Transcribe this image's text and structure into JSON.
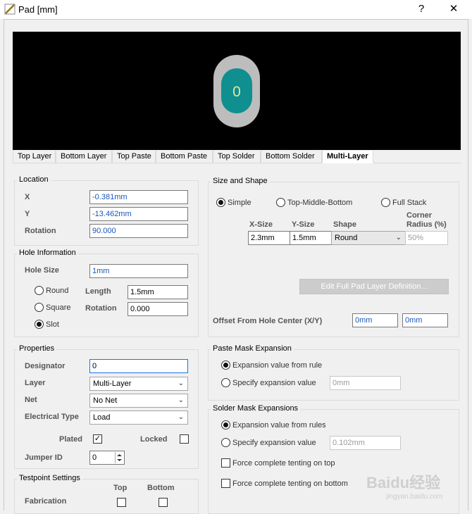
{
  "window": {
    "title": "Pad [mm]",
    "help": "?",
    "close": "✕"
  },
  "preview": {
    "pad_designator": "0"
  },
  "layer_tabs": [
    "Top Layer",
    "Bottom Layer",
    "Top Paste",
    "Bottom Paste",
    "Top Solder",
    "Bottom Solder",
    "Multi-Layer"
  ],
  "active_tab": "Multi-Layer",
  "location": {
    "title": "Location",
    "x_label": "X",
    "x_value": "-0.381mm",
    "y_label": "Y",
    "y_value": "-13.462mm",
    "rotation_label": "Rotation",
    "rotation_value": "90.000"
  },
  "hole": {
    "title": "Hole Information",
    "size_label": "Hole Size",
    "size_value": "1mm",
    "round_label": "Round",
    "square_label": "Square",
    "slot_label": "Slot",
    "selected": "Slot",
    "length_label": "Length",
    "length_value": "1.5mm",
    "rotation_label": "Rotation",
    "rotation_value": "0.000"
  },
  "properties": {
    "title": "Properties",
    "designator_label": "Designator",
    "designator_value": "0",
    "layer_label": "Layer",
    "layer_value": "Multi-Layer",
    "net_label": "Net",
    "net_value": "No Net",
    "electrical_label": "Electrical Type",
    "electrical_value": "Load",
    "plated_label": "Plated",
    "plated_checked": true,
    "locked_label": "Locked",
    "locked_checked": false,
    "jumper_label": "Jumper ID",
    "jumper_value": "0"
  },
  "testpoint": {
    "title": "Testpoint Settings",
    "top_label": "Top",
    "bottom_label": "Bottom",
    "fabrication_label": "Fabrication"
  },
  "size_shape": {
    "title": "Size and Shape",
    "simple_label": "Simple",
    "tmb_label": "Top-Middle-Bottom",
    "full_label": "Full Stack",
    "selected": "Simple",
    "col_xsize": "X-Size",
    "col_ysize": "Y-Size",
    "col_shape": "Shape",
    "col_corner": "Corner Radius (%)",
    "xsize_value": "2.3mm",
    "ysize_value": "1.5mm",
    "shape_value": "Round",
    "corner_value": "50%",
    "edit_button": "Edit Full Pad Layer Definition...",
    "offset_label": "Offset From Hole Center (X/Y)",
    "offset_x": "0mm",
    "offset_y": "0mm"
  },
  "paste_mask": {
    "title": "Paste Mask Expansion",
    "rule_label": "Expansion value from rule",
    "specify_label": "Specify expansion value",
    "specify_value": "0mm",
    "selected": "rule"
  },
  "solder_mask": {
    "title": "Solder Mask Expansions",
    "rule_label": "Expansion value from rules",
    "specify_label": "Specify expansion value",
    "specify_value": "0.102mm",
    "tent_top_label": "Force complete tenting on top",
    "tent_bottom_label": "Force complete tenting on bottom",
    "selected": "rule"
  },
  "watermark": {
    "brand": "Baidu经验",
    "url": "jingyan.baidu.com"
  },
  "colors": {
    "pad_ring": "#bdbdbd",
    "pad_fill": "#0f8f8f",
    "pad_text": "#e8e6a0",
    "value_text": "#1a56b8"
  }
}
